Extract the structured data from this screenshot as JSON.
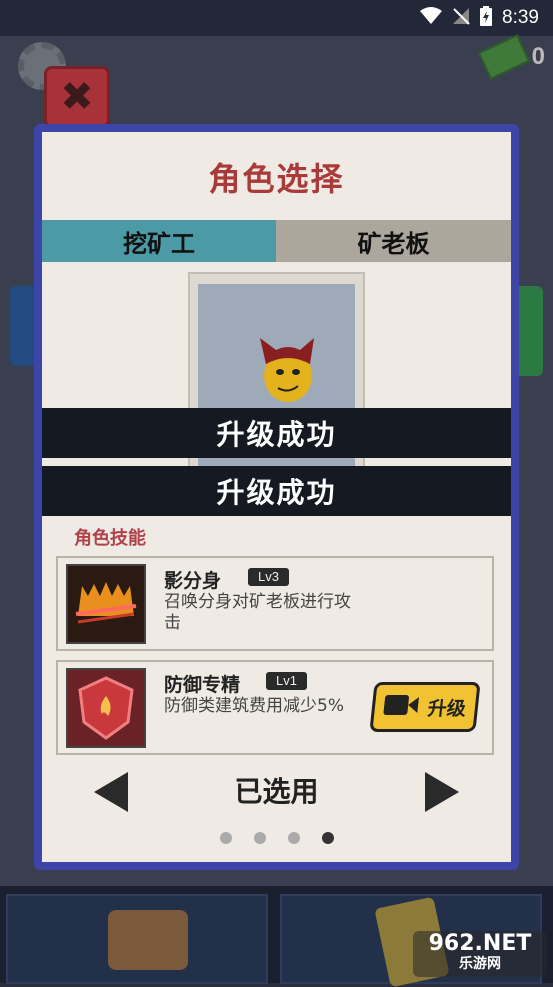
{
  "status_bar": {
    "time": "8:39"
  },
  "hud": {
    "money": "0"
  },
  "dialog": {
    "title": "角色选择",
    "tabs": [
      {
        "label": "挖矿工"
      },
      {
        "label": "矿老板"
      }
    ],
    "banners": [
      "升级成功",
      "升级成功"
    ],
    "skills_title": "角色技能",
    "skills": [
      {
        "name": "影分身",
        "level": "Lv3",
        "description": "召唤分身对矿老板进行攻击"
      },
      {
        "name": "防御专精",
        "level": "Lv1",
        "description": "防御类建筑费用减少5%",
        "upgrade_label": "升级"
      }
    ],
    "select_label": "已选用",
    "page_count": 4,
    "active_page": 4,
    "colors": {
      "title": "#a83a3a",
      "tab_active": "#4b9aa6",
      "tab_inactive": "#aca69d",
      "panel_border": "#3d45a8",
      "upgrade_button": "#f1c232"
    }
  },
  "watermark": {
    "main": "962.NET",
    "sub": "乐游网"
  }
}
